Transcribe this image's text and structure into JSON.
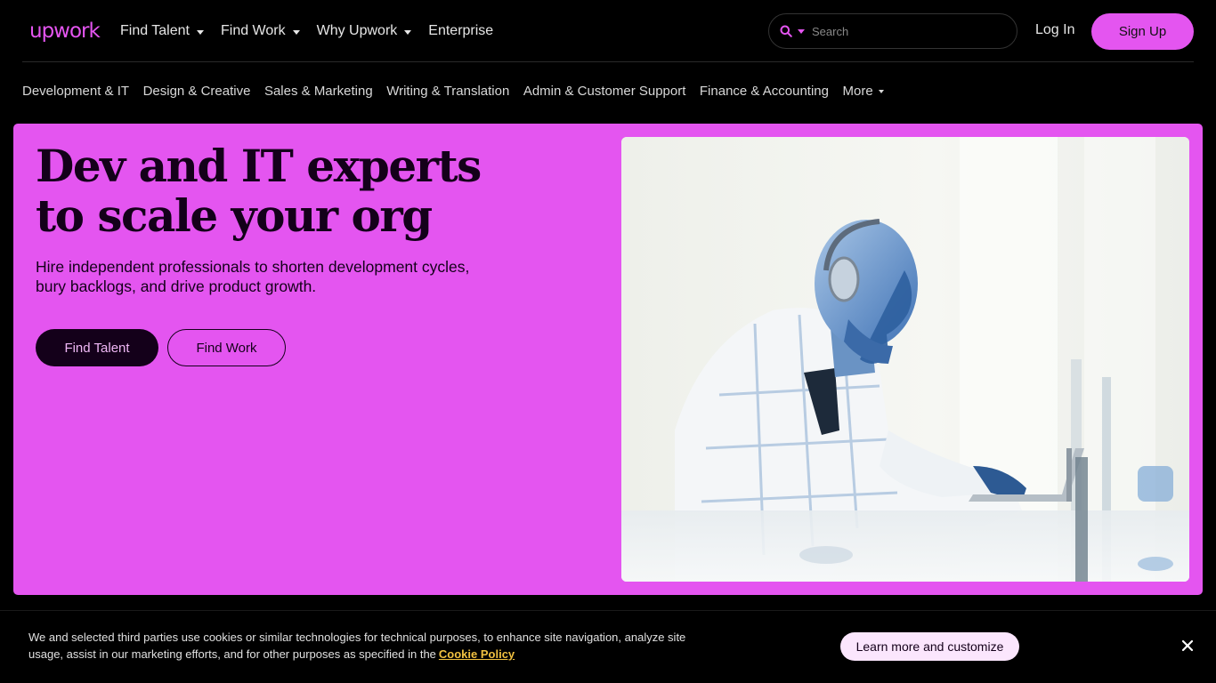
{
  "header": {
    "logo_text": "upwork",
    "nav": [
      {
        "label": "Find Talent",
        "dropdown": true
      },
      {
        "label": "Find Work",
        "dropdown": true
      },
      {
        "label": "Why Upwork",
        "dropdown": true
      },
      {
        "label": "Enterprise",
        "dropdown": false
      }
    ],
    "search_placeholder": "Search",
    "login_label": "Log In",
    "signup_label": "Sign Up"
  },
  "categories": [
    {
      "label": "Development & IT"
    },
    {
      "label": "Design & Creative"
    },
    {
      "label": "Sales & Marketing"
    },
    {
      "label": "Writing & Translation"
    },
    {
      "label": "Admin & Customer Support"
    },
    {
      "label": "Finance & Accounting"
    },
    {
      "label": "More",
      "dropdown": true
    }
  ],
  "hero": {
    "title": "Dev and IT experts to scale your org",
    "subtitle": "Hire independent professionals to shorten development cycles, bury backlogs, and drive product growth.",
    "primary_button": "Find Talent",
    "secondary_button": "Find Work"
  },
  "cookie_banner": {
    "text": "We and selected third parties use cookies or similar technologies for technical purposes, to enhance site navigation, analyze site usage, assist in our marketing efforts, and for other purposes as specified in the",
    "link_label": "Cookie Policy",
    "customize_label": "Learn more and customize"
  },
  "colors": {
    "brand": "#e455f0",
    "dark": "#14001a",
    "background": "#000000",
    "link_highlight": "#f0c040"
  },
  "icons": [
    "search-icon",
    "chevron-down-icon",
    "close-icon"
  ]
}
